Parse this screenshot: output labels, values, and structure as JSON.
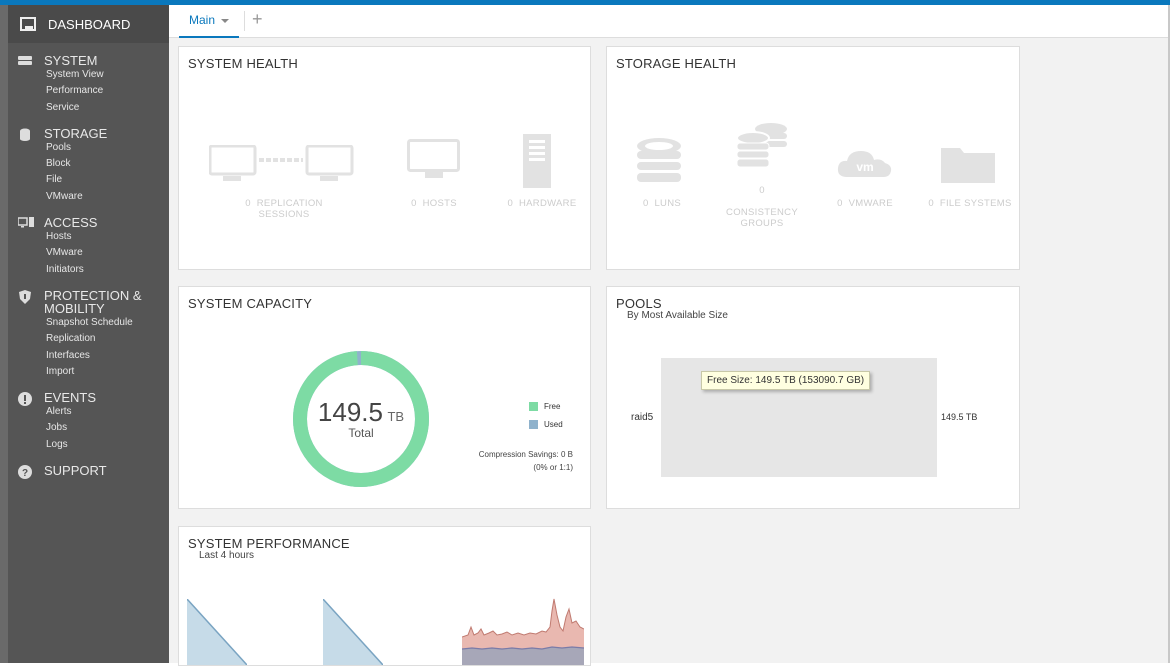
{
  "sidebar": {
    "dashboard": "DASHBOARD",
    "sections": [
      {
        "title": "SYSTEM",
        "icon": "server-icon",
        "items": [
          "System View",
          "Performance",
          "Service"
        ]
      },
      {
        "title": "STORAGE",
        "icon": "database-icon",
        "items": [
          "Pools",
          "Block",
          "File",
          "VMware"
        ]
      },
      {
        "title": "ACCESS",
        "icon": "hosts-icon",
        "items": [
          "Hosts",
          "VMware",
          "Initiators"
        ]
      },
      {
        "title": "PROTECTION &",
        "title2": "MOBILITY",
        "icon": "shield-icon",
        "items": [
          "Snapshot Schedule",
          "Replication",
          "Interfaces",
          "Import"
        ]
      },
      {
        "title": "EVENTS",
        "icon": "alert-icon",
        "items": [
          "Alerts",
          "Jobs",
          "Logs"
        ]
      },
      {
        "title": "SUPPORT",
        "icon": "help-icon",
        "items": []
      }
    ]
  },
  "tabs": {
    "main": "Main",
    "add": "+"
  },
  "system_health": {
    "title": "SYSTEM HEALTH",
    "items": [
      {
        "count": "0",
        "label": "REPLICATION SESSIONS"
      },
      {
        "count": "0",
        "label": "HOSTS"
      },
      {
        "count": "0",
        "label": "HARDWARE"
      }
    ]
  },
  "storage_health": {
    "title": "STORAGE HEALTH",
    "items": [
      {
        "count": "0",
        "label": "LUNS"
      },
      {
        "count": "0",
        "label": "CONSISTENCY",
        "label2": "GROUPS"
      },
      {
        "count": "0",
        "label": "VMWARE"
      },
      {
        "count": "0",
        "label": "FILE SYSTEMS"
      }
    ],
    "vm_text": "vm"
  },
  "capacity": {
    "title": "SYSTEM CAPACITY",
    "value": "149.5",
    "unit": "TB",
    "total_label": "Total",
    "free_fraction": 0.99,
    "legend_free": "Free",
    "legend_used": "Used",
    "compression": "Compression Savings:  0 B",
    "compression2": "(0% or 1:1)",
    "colors": {
      "free": "#7ddba4",
      "used": "#8fb2cc"
    }
  },
  "pools": {
    "title": "POOLS",
    "subtitle": "By Most Available Size",
    "pool_name": "raid5",
    "pool_size": "149.5 TB",
    "tooltip": "Free Size: 149.5 TB (153090.7 GB)"
  },
  "performance": {
    "title": "SYSTEM PERFORMANCE",
    "subtitle": "Last 4 hours"
  }
}
